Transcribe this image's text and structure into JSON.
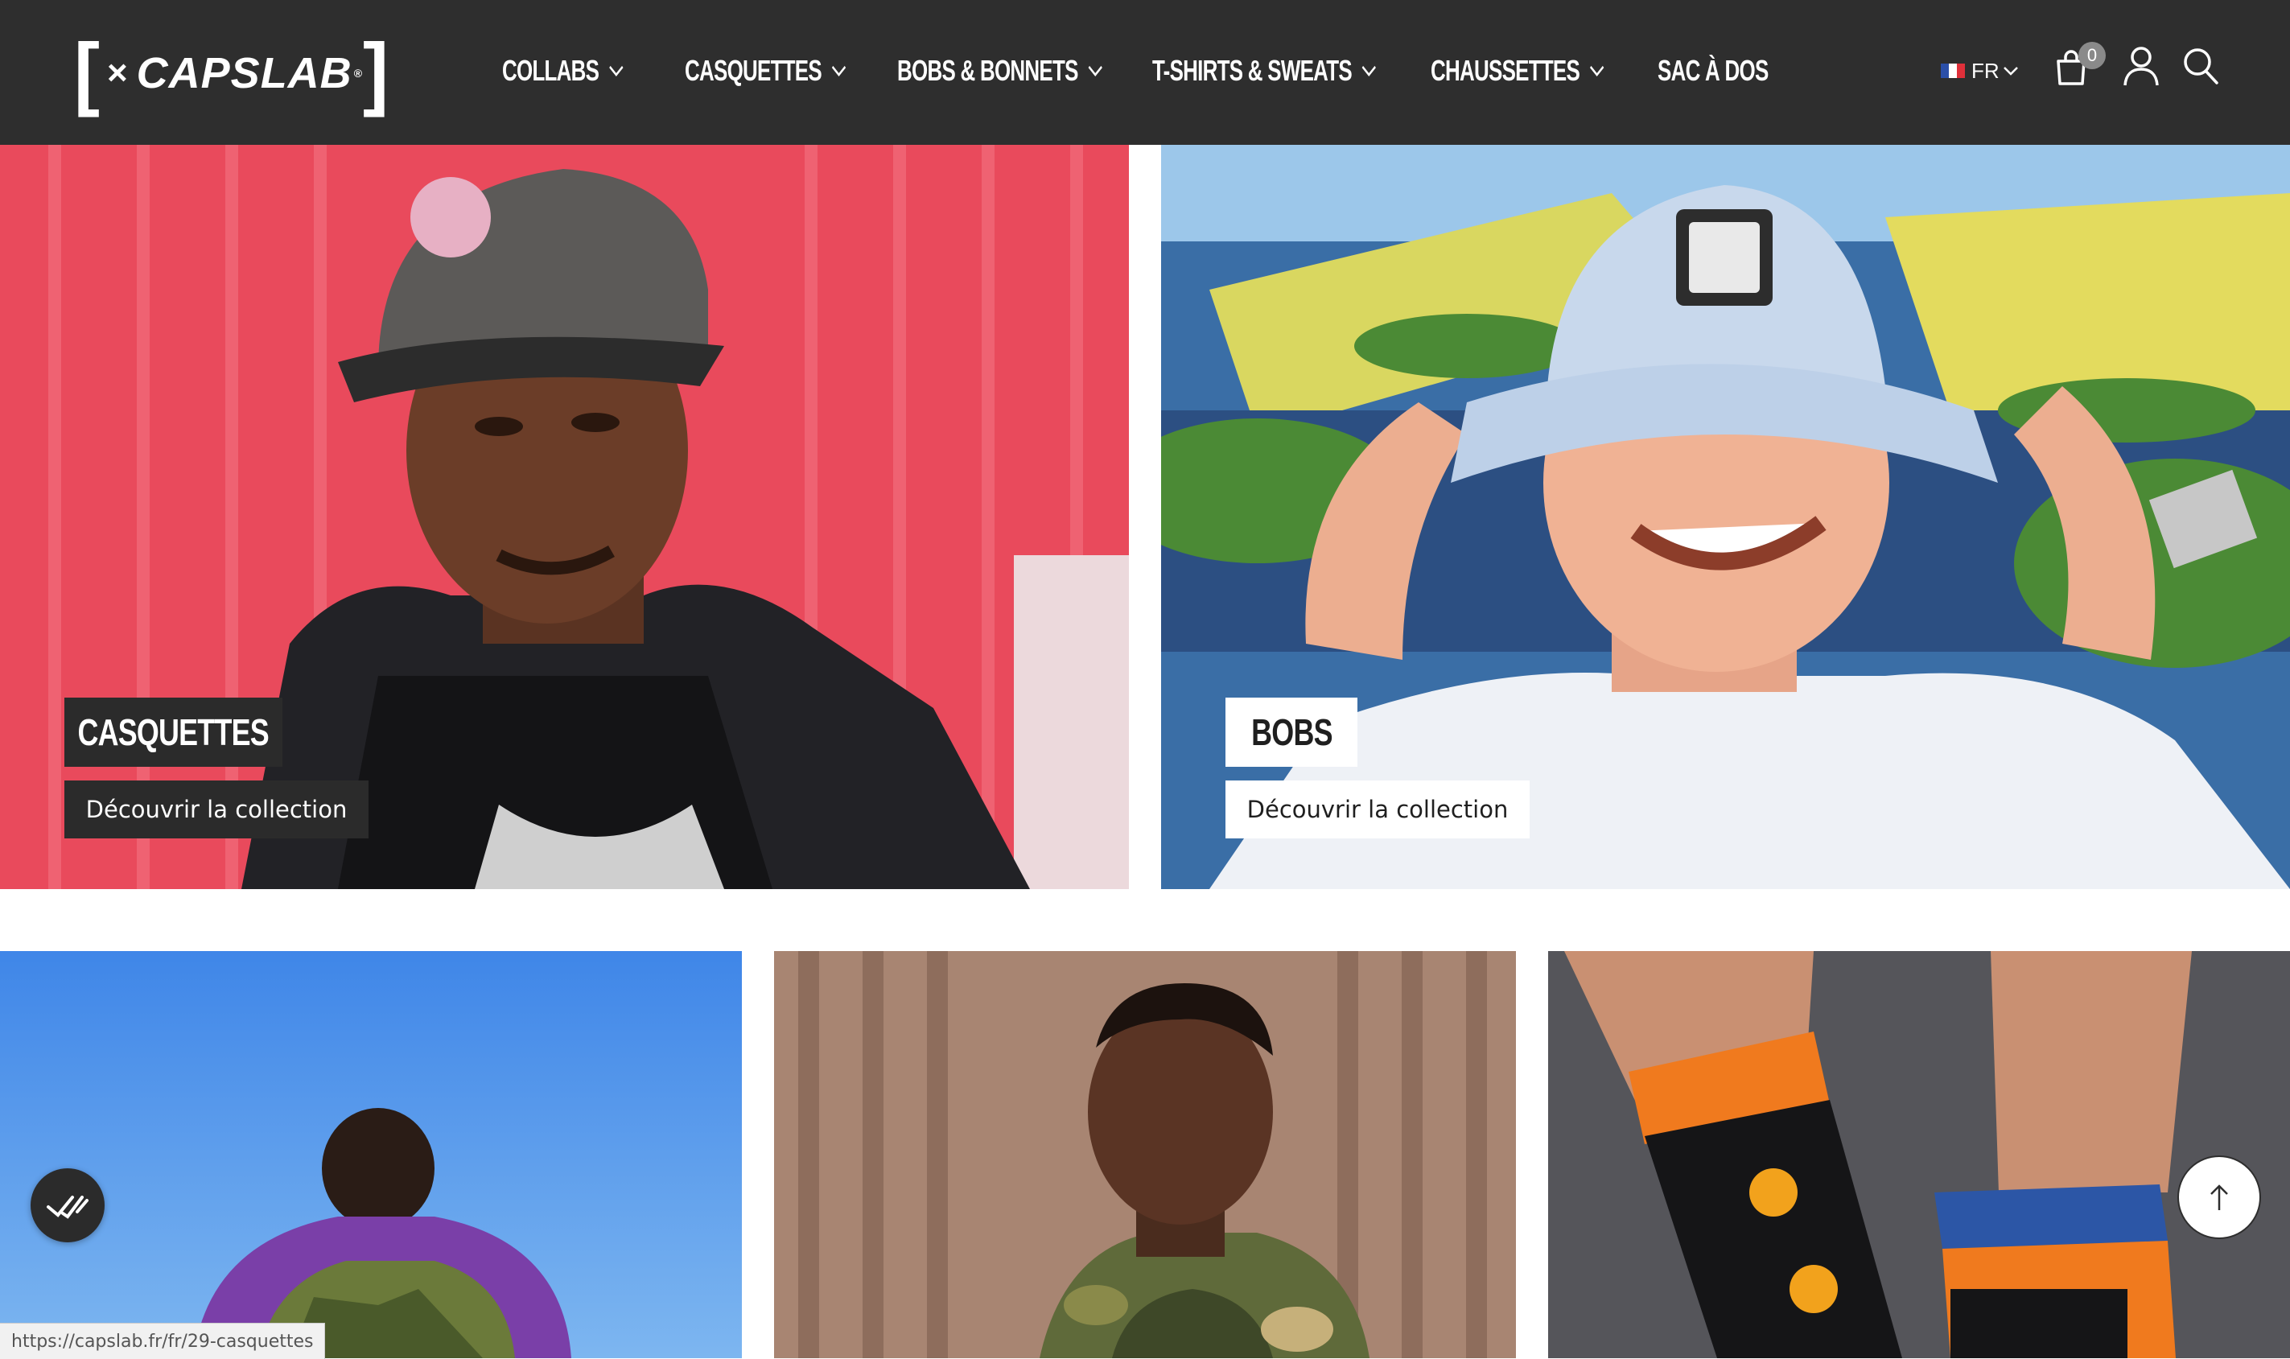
{
  "brand": {
    "logo_text": "CAPSLAB",
    "logo_symbol": "×",
    "logo_mark": "®"
  },
  "nav": {
    "items": [
      {
        "label": "COLLABS",
        "has_dropdown": true
      },
      {
        "label": "CASQUETTES",
        "has_dropdown": true
      },
      {
        "label": "BOBS & BONNETS",
        "has_dropdown": true
      },
      {
        "label": "T-SHIRTS & SWEATS",
        "has_dropdown": true
      },
      {
        "label": "CHAUSSETTES",
        "has_dropdown": true
      },
      {
        "label": "SAC À DOS",
        "has_dropdown": false
      }
    ]
  },
  "header_tools": {
    "language": "FR",
    "cart_count": "0",
    "icons": [
      "cart-icon",
      "user-icon",
      "search-icon"
    ]
  },
  "tiles": {
    "casquettes": {
      "title": "CASQUETTES",
      "cta": "Découvrir la collection"
    },
    "bobs": {
      "title": "BOBS",
      "cta": "Découvrir la collection"
    }
  },
  "status_bar": {
    "url": "https://capslab.fr/fr/29-casquettes"
  },
  "colors": {
    "header_bg": "#2e2e2e",
    "tag_dark": "#2b2b2b",
    "tag_light": "#ffffff",
    "accent_red": "#e94a5c",
    "sky_blue": "#3f86e8"
  }
}
